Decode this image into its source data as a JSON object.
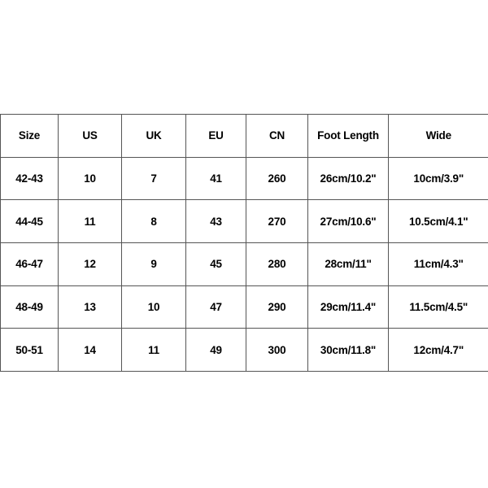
{
  "table": {
    "headers": [
      "Size",
      "US",
      "UK",
      "EU",
      "CN",
      "Foot Length",
      "Wide"
    ],
    "rows": [
      {
        "size": "42-43",
        "us": "10",
        "uk": "7",
        "eu": "41",
        "cn": "260",
        "foot_length": "26cm/10.2\"",
        "wide": "10cm/3.9\""
      },
      {
        "size": "44-45",
        "us": "11",
        "uk": "8",
        "eu": "43",
        "cn": "270",
        "foot_length": "27cm/10.6\"",
        "wide": "10.5cm/4.1\""
      },
      {
        "size": "46-47",
        "us": "12",
        "uk": "9",
        "eu": "45",
        "cn": "280",
        "foot_length": "28cm/11\"",
        "wide": "11cm/4.3\""
      },
      {
        "size": "48-49",
        "us": "13",
        "uk": "10",
        "eu": "47",
        "cn": "290",
        "foot_length": "29cm/11.4\"",
        "wide": "11.5cm/4.5\""
      },
      {
        "size": "50-51",
        "us": "14",
        "uk": "11",
        "eu": "49",
        "cn": "300",
        "foot_length": "30cm/11.8\"",
        "wide": "12cm/4.7\""
      }
    ]
  },
  "colors": {
    "background": "#ffffff",
    "text": "#000000",
    "border": "#555555"
  }
}
